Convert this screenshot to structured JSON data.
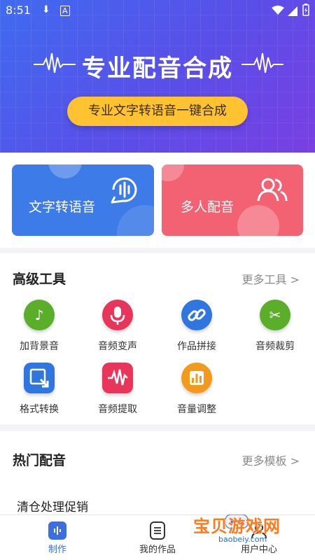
{
  "status_bar": {
    "time": "8:51"
  },
  "hero": {
    "title": "专业配音合成",
    "pill_label": "专业文字转语音一键合成"
  },
  "feature_cards": [
    {
      "label": "文字转语音",
      "icon": "mic-bubble-icon"
    },
    {
      "label": "多人配音",
      "icon": "people-icon"
    }
  ],
  "tools_section": {
    "title": "高级工具",
    "more_label": "更多工具 >",
    "items": [
      {
        "label": "加背景音",
        "icon": "music-note-icon",
        "color": "#5aae2a"
      },
      {
        "label": "音频变声",
        "icon": "microphone-icon",
        "color": "#e8365a"
      },
      {
        "label": "作品拼接",
        "icon": "link-icon",
        "color": "#2f76e0"
      },
      {
        "label": "音频裁剪",
        "icon": "scissors-icon",
        "color": "#5aae2a"
      },
      {
        "label": "格式转换",
        "icon": "convert-icon",
        "color": "#2f76e0"
      },
      {
        "label": "音频提取",
        "icon": "waveform-icon",
        "color": "#e8365a"
      },
      {
        "label": "音量调整",
        "icon": "volume-bars-icon",
        "color": "#f39a1c"
      }
    ]
  },
  "hot_section": {
    "title": "热门配音",
    "more_label": "更多模板 >",
    "items": [
      {
        "label": "清仓处理促销"
      }
    ]
  },
  "bottom_nav": {
    "items": [
      {
        "label": "制作",
        "icon": "make-icon",
        "active": true
      },
      {
        "label": "我的作品",
        "icon": "document-icon",
        "active": false
      },
      {
        "label": "用户中心",
        "icon": "user-icon",
        "active": false
      }
    ]
  },
  "watermark": {
    "text": "宝贝游戏网",
    "url": "baobeiy.com"
  }
}
